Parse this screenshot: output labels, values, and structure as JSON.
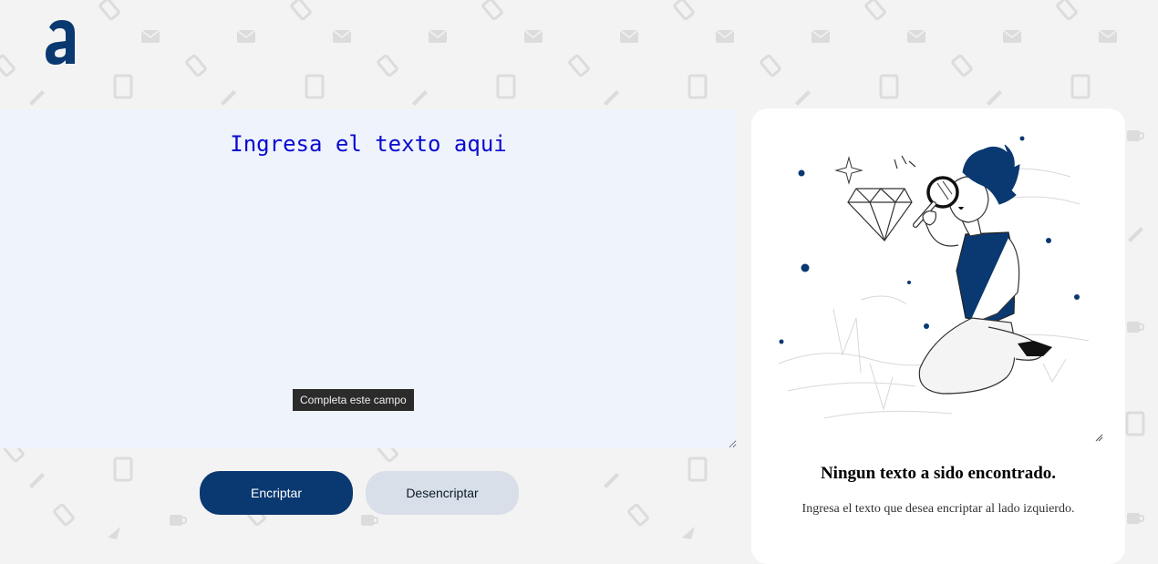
{
  "logo": {
    "letter": "a",
    "icon": "alura-logo-icon",
    "color": "#0a3871"
  },
  "input": {
    "placeholder": "Ingresa el texto aqui",
    "value": "",
    "validation_tooltip": "Completa este campo"
  },
  "buttons": {
    "encrypt_label": "Encriptar",
    "decrypt_label": "Desencriptar"
  },
  "output": {
    "illustration_icon": "person-with-magnifying-glass-illustration",
    "title": "Ningun texto a sido encontrado.",
    "description": "Ingresa el texto que desea encriptar al lado izquierdo."
  },
  "colors": {
    "primary": "#0a3871",
    "input_bg": "#eff3fc",
    "placeholder_text": "#0a0ad0",
    "secondary_button": "#d8dfe8",
    "page_bg": "#f3f3f3"
  }
}
